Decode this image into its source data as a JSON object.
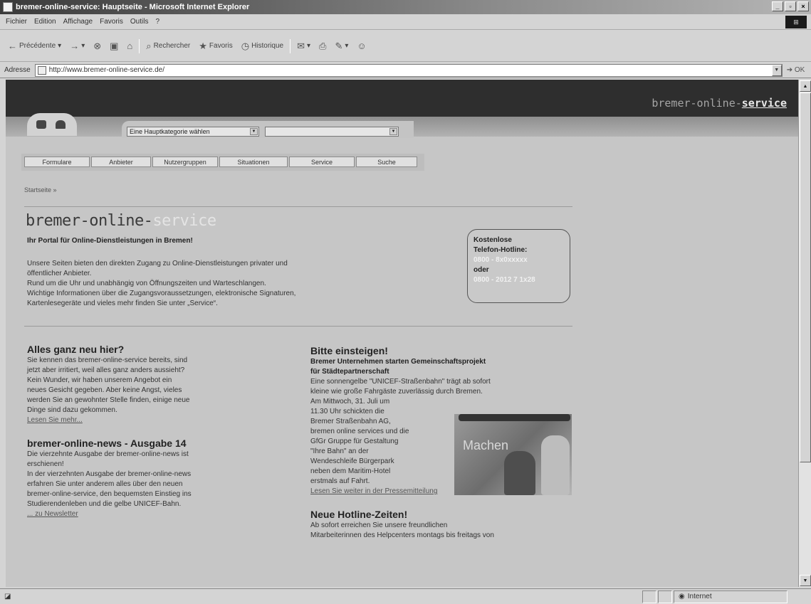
{
  "window": {
    "title": "bremer-online-service: Hauptseite - Microsoft Internet Explorer",
    "buttons": [
      "_",
      "▫",
      "×"
    ]
  },
  "menubar": {
    "items": [
      "Fichier",
      "Edition",
      "Affichage",
      "Favoris",
      "Outils",
      "?"
    ]
  },
  "toolbar": {
    "back": "Précédente",
    "search": "Rechercher",
    "favorites": "Favoris",
    "history": "Historique"
  },
  "addressbar": {
    "label": "Adresse",
    "url": "http://www.bremer-online-service.de/",
    "go": "OK"
  },
  "statusbar": {
    "zone": "Internet"
  },
  "site": {
    "logo_prefix": "bremer-online-",
    "logo_suffix": "service",
    "category_select": "Eine Hauptkategorie wählen",
    "sub_select": "",
    "tabs": [
      "Formulare",
      "Anbieter",
      "Nutzergruppen",
      "Situationen",
      "Service",
      "Suche"
    ],
    "breadcrumb": "Startseite »",
    "brand_prefix": "bremer-online-",
    "brand_suffix": "service",
    "tagline": "Ihr Portal für Online-Dienstleistungen in Bremen!",
    "intro": [
      "Unsere Seiten bieten den direkten Zugang zu Online-Dienstleistungen privater und",
      "öffentlicher Anbieter.",
      "Rund um die Uhr und unabhängig von Öffnungszeiten und Warteschlangen.",
      "Wichtige Informationen über die Zugangsvoraussetzungen, elektronische Signaturen,",
      "Kartenlesegeräte und vieles mehr finden Sie unter „Service“."
    ],
    "hotline": {
      "line1": "Kostenlose",
      "line2": "Telefon-Hotline:",
      "number1": "0800 - 8x0xxxxx",
      "or": "oder",
      "number2": "0800 - 2012 7 1x28"
    },
    "left": {
      "h1": "Alles ganz neu hier?",
      "p1": [
        "Sie kennen das bremer-online-service bereits, sind",
        "jetzt aber irritiert, weil alles ganz anders aussieht?",
        "Kein Wunder, wir haben unserem Angebot ein",
        "neues Gesicht gegeben. Aber keine Angst, vieles",
        "werden Sie an gewohnter Stelle finden, einige neue",
        "Dinge sind dazu gekommen."
      ],
      "link1": "Lesen Sie mehr...",
      "h2": "bremer-online-news - Ausgabe 14",
      "p2": [
        "Die vierzehnte Ausgabe der bremer-online-news ist",
        "erschienen!",
        "In der vierzehnten Ausgabe der bremer-online-news",
        "erfahren Sie unter anderem alles über den neuen",
        "bremer-online-service, den bequemsten Einstieg ins",
        "Studierendenleben und die gelbe UNICEF-Bahn."
      ],
      "link2": "... zu Newsletter"
    },
    "right": {
      "h1": "Bitte einsteigen!",
      "bold1": "Bremer Unternehmen starten Gemeinschaftsprojekt",
      "bold2": "für Städtepartnerschaft",
      "p_full": [
        "Eine sonnengelbe \"UNICEF-Straßenbahn\" trägt ab sofort",
        "kleine wie große Fahrgäste zuverlässig durch Bremen."
      ],
      "p_wrap": [
        "Am Mittwoch, 31. Juli um",
        "11.30 Uhr schickten die",
        "Bremer Straßenbahn AG,",
        "bremen online services und die",
        "GfGr Gruppe für Gestaltung",
        "\"Ihre Bahn\" an der",
        "Wendeschleife Bürgerpark",
        "neben dem Maritim-Hotel",
        "erstmals auf Fahrt."
      ],
      "photo_text": "Machen",
      "link1": "Lesen Sie weiter in der Pressemitteilung",
      "h2": "Neue Hotline-Zeiten!",
      "p2": [
        "Ab sofort erreichen Sie unsere freundlichen",
        "Mitarbeiterinnen des Helpcenters montags bis freitags von"
      ]
    }
  }
}
